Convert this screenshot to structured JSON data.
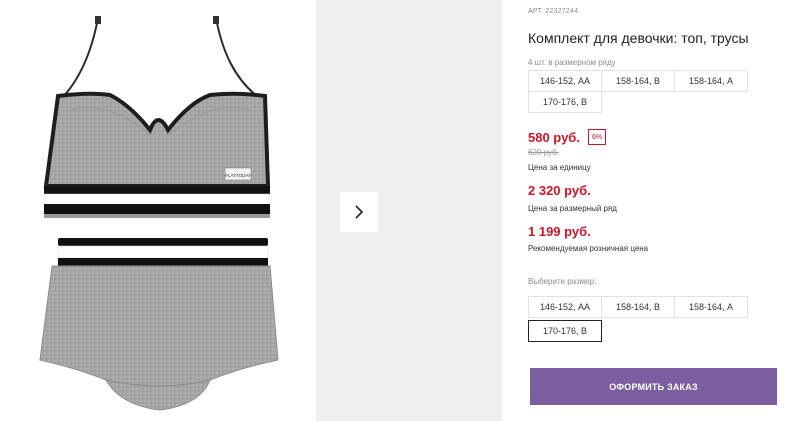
{
  "product": {
    "sku": "АРТ. 22327244",
    "title": "Комплект для девочки: топ, трусы",
    "pack_note": "4 шт. в размерном ряду",
    "pack_sizes": [
      "146-152, АА",
      "158-164, B",
      "158-164, А",
      "170-176, B"
    ],
    "choose_label": "Выберите размер:",
    "select_sizes": [
      "146-152, АА",
      "158-164, B",
      "158-164, А",
      "170-176, B"
    ],
    "selected_size": "170-176, B"
  },
  "prices": {
    "unit_price": "580 руб.",
    "discount_badge": "6%",
    "old_price": "620 руб.",
    "unit_caption": "Цена за единицу",
    "set_price": "2 320 руб.",
    "set_caption": "Цена за размерный ряд",
    "retail_price": "1 199 руб.",
    "retail_caption": "Рекомендуемая розничная цена"
  },
  "product_image": {
    "tag_text": "PLAYTODAY"
  },
  "actions": {
    "order_label": "ОФОРМИТЬ ЗАКАЗ"
  },
  "icons": {
    "next": "chevron-right-icon"
  },
  "colors": {
    "price_red": "#c9162b",
    "order_button": "#7a5ea0",
    "fabric_gray": "#a9a9a9"
  }
}
